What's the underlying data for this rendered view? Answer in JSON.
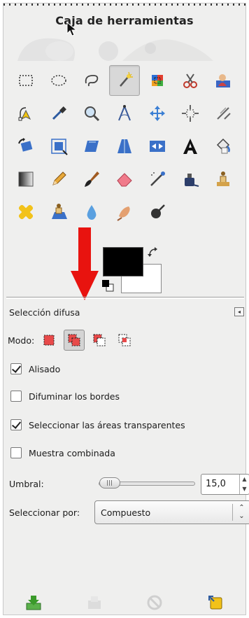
{
  "window": {
    "title": "Caja de herramientas"
  },
  "toolbox": {
    "tools": [
      {
        "icon": "rect-select-icon"
      },
      {
        "icon": "ellipse-select-icon"
      },
      {
        "icon": "free-select-icon"
      },
      {
        "icon": "fuzzy-select-icon",
        "active": true
      },
      {
        "icon": "select-by-color-icon"
      },
      {
        "icon": "scissors-select-icon"
      },
      {
        "icon": "foreground-select-icon"
      },
      {
        "icon": "paths-icon"
      },
      {
        "icon": "color-picker-icon"
      },
      {
        "icon": "zoom-icon"
      },
      {
        "icon": "measure-icon"
      },
      {
        "icon": "move-icon"
      },
      {
        "icon": "align-icon"
      },
      {
        "icon": "crop-icon"
      },
      {
        "icon": "rotate-icon"
      },
      {
        "icon": "scale-icon"
      },
      {
        "icon": "shear-icon"
      },
      {
        "icon": "perspective-icon"
      },
      {
        "icon": "flip-icon"
      },
      {
        "icon": "text-icon"
      },
      {
        "icon": "bucket-fill-icon"
      },
      {
        "icon": "blend-icon"
      },
      {
        "icon": "pencil-icon"
      },
      {
        "icon": "paintbrush-icon"
      },
      {
        "icon": "eraser-icon"
      },
      {
        "icon": "airbrush-icon"
      },
      {
        "icon": "ink-icon"
      },
      {
        "icon": "clone-icon"
      },
      {
        "icon": "heal-icon"
      },
      {
        "icon": "perspective-clone-icon"
      },
      {
        "icon": "blur-sharpen-icon"
      },
      {
        "icon": "smudge-icon"
      },
      {
        "icon": "dodge-burn-icon"
      }
    ],
    "colors": {
      "foreground": "#000000",
      "background": "#ffffff",
      "annotation_arrow": "#e8130f"
    }
  },
  "tool_options": {
    "title": "Selección difusa",
    "mode_label": "Modo:",
    "modes": [
      {
        "icon": "replace-selection-icon",
        "active": false
      },
      {
        "icon": "add-selection-icon",
        "active": true
      },
      {
        "icon": "subtract-selection-icon",
        "active": false
      },
      {
        "icon": "intersect-selection-icon",
        "active": false
      }
    ],
    "checkboxes": [
      {
        "label": "Alisado",
        "checked": true
      },
      {
        "label": "Difuminar los bordes",
        "checked": false
      },
      {
        "label": "Seleccionar las áreas transparentes",
        "checked": true
      },
      {
        "label": "Muestra combinada",
        "checked": false
      }
    ],
    "threshold": {
      "label": "Umbral:",
      "value": "15,0",
      "slider_fraction": 0.059
    },
    "select_by": {
      "label": "Seleccionar por:",
      "value": "Compuesto"
    }
  },
  "bottom_bar": [
    {
      "icon": "save-options-icon",
      "enabled": true
    },
    {
      "icon": "restore-options-icon",
      "enabled": false
    },
    {
      "icon": "delete-options-icon",
      "enabled": false
    },
    {
      "icon": "reset-options-icon",
      "enabled": true
    }
  ]
}
